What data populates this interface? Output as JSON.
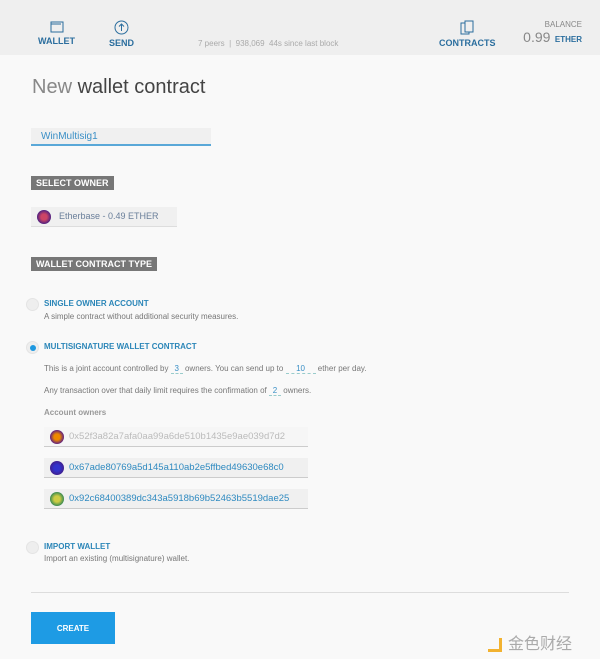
{
  "header": {
    "wallet": "WALLET",
    "send": "SEND",
    "contracts": "CONTRACTS",
    "peers": "7 peers",
    "block": "938,069",
    "since": "44s since last block",
    "balance_label": "BALANCE",
    "balance_value": "0.99",
    "balance_unit": "ETHER"
  },
  "page": {
    "title_light": "New",
    "title_bold": "wallet contract",
    "name_value": "WinMultisig1"
  },
  "select_owner": {
    "label": "SELECT OWNER",
    "value": "Etherbase - 0.49 ETHER"
  },
  "type": {
    "label": "WALLET CONTRACT TYPE",
    "single": {
      "title": "SINGLE OWNER ACCOUNT",
      "desc": "A simple contract without additional security measures."
    },
    "multi": {
      "title": "MULTISIGNATURE WALLET CONTRACT",
      "t1": "This is a joint account controlled by",
      "owners": "3",
      "t2": "owners. You can send up to",
      "limit": "10",
      "t3": "ether per day.",
      "t4": "Any transaction over that daily limit requires the confirmation of",
      "confirm": "2",
      "t5": "owners.",
      "owners_label": "Account owners",
      "addresses": [
        "0x52f3a82a7afa0aa99a6de510b1435e9ae039d7d2",
        "0x67ade80769a5d145a110ab2e5ffbed49630e68c0",
        "0x92c68400389dc343a5918b69b52463b5519dae25"
      ]
    },
    "import": {
      "title": "IMPORT WALLET",
      "desc": "Import an existing (multisignature) wallet."
    }
  },
  "create": "CREATE",
  "watermark": "金色财经"
}
